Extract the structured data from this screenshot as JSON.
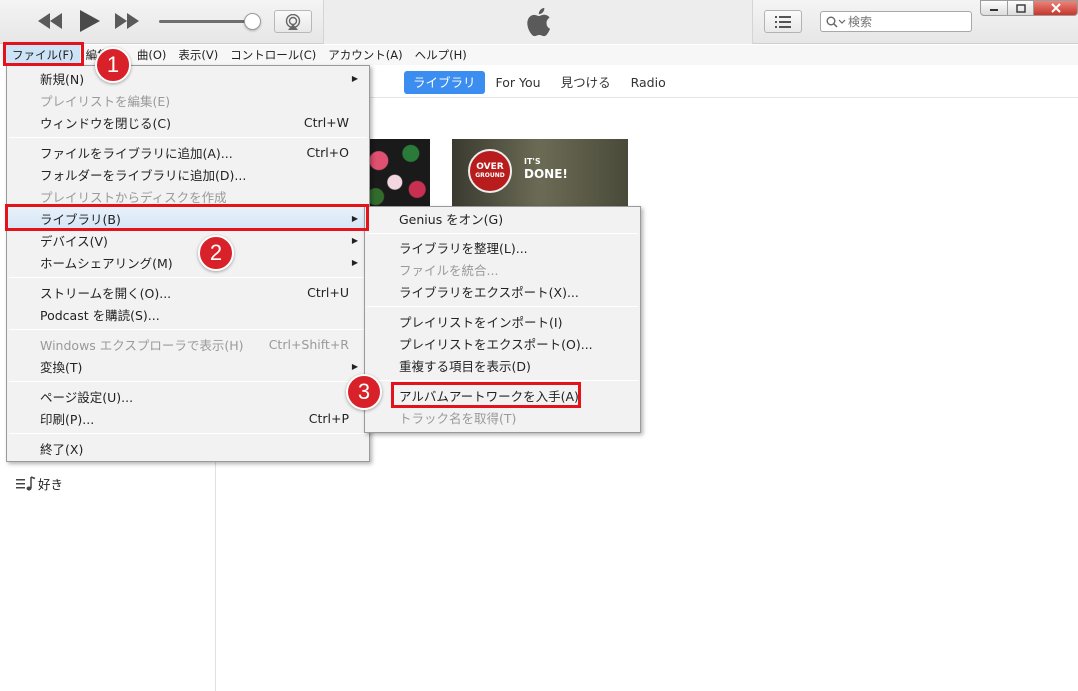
{
  "window": {
    "brand_icon": "apple-logo-icon",
    "search_placeholder": "検索",
    "controls": [
      "minimize-icon",
      "maximize-icon",
      "close-icon"
    ]
  },
  "menubar": [
    {
      "label": "ファイル(F)"
    },
    {
      "label": "編集(E)"
    },
    {
      "label": "曲(O)"
    },
    {
      "label": "表示(V)"
    },
    {
      "label": "コントロール(C)"
    },
    {
      "label": "アカウント(A)"
    },
    {
      "label": "ヘルプ(H)"
    }
  ],
  "tabs": [
    {
      "label": "ライブラリ",
      "selected": true
    },
    {
      "label": "For You"
    },
    {
      "label": "見つける"
    },
    {
      "label": "Radio"
    }
  ],
  "file_menu": [
    {
      "label": "新規(N)",
      "submenu": true
    },
    {
      "label": "プレイリストを編集(E)",
      "disabled": true
    },
    {
      "label": "ウィンドウを閉じる(C)",
      "shortcut": "Ctrl+W"
    },
    {
      "label": "ファイルをライブラリに追加(A)...",
      "shortcut": "Ctrl+O"
    },
    {
      "label": "フォルダーをライブラリに追加(D)..."
    },
    {
      "label": "プレイリストからディスクを作成",
      "disabled": true
    },
    {
      "label": "ライブラリ(B)",
      "submenu": true,
      "highlighted": true
    },
    {
      "label": "デバイス(V)",
      "submenu": true
    },
    {
      "label": "ホームシェアリング(M)",
      "submenu": true
    },
    {
      "label": "ストリームを開く(O)...",
      "shortcut": "Ctrl+U"
    },
    {
      "label": "Podcast を購読(S)..."
    },
    {
      "label": "Windows エクスプローラで表示(H)",
      "shortcut": "Ctrl+Shift+R",
      "disabled": true
    },
    {
      "label": "変換(T)",
      "submenu": true
    },
    {
      "label": "ページ設定(U)..."
    },
    {
      "label": "印刷(P)...",
      "shortcut": "Ctrl+P"
    },
    {
      "label": "終了(X)"
    }
  ],
  "library_submenu": [
    {
      "label": "Genius をオン(G)"
    },
    {
      "label": "ライブラリを整理(L)..."
    },
    {
      "label": "ファイルを統合...",
      "disabled": true
    },
    {
      "label": "ライブラリをエクスポート(X)..."
    },
    {
      "label": "プレイリストをインポート(I)"
    },
    {
      "label": "プレイリストをエクスポート(O)..."
    },
    {
      "label": "重複する項目を表示(D)"
    },
    {
      "label": "アルバムアートワークを入手(A)"
    },
    {
      "label": "トラック名を取得(T)",
      "disabled": true
    }
  ],
  "sidebar": {
    "visible_item": "好き"
  },
  "albums": [
    {
      "art": "floral-pattern"
    },
    {
      "logo_text_1": "OVER",
      "logo_text_2": "GROUND",
      "text_1": "IT'S",
      "text_2": "DONE!"
    }
  ],
  "annotations": {
    "step1": "1",
    "step2": "2",
    "step3": "3",
    "highlight_color": "#e3121b"
  },
  "colors": {
    "accent": "#3b8df0",
    "menu_bg": "#f2f2f2",
    "disabled_text": "#9a9a9a"
  }
}
